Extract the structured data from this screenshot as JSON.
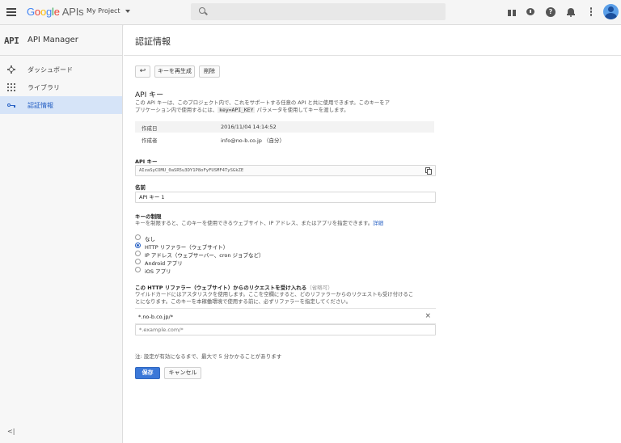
{
  "topbar": {
    "logo_google": [
      "G",
      "o",
      "o",
      "g",
      "l",
      "e"
    ],
    "logo_apis": "APIs",
    "project": "My Project",
    "search_placeholder": "",
    "help_glyph": "?"
  },
  "sidebar": {
    "logo_text": "API",
    "title": "API Manager",
    "items": [
      {
        "label": "ダッシュボード",
        "icon": "dashboard-icon"
      },
      {
        "label": "ライブラリ",
        "icon": "library-icon"
      },
      {
        "label": "認証情報",
        "icon": "key-icon",
        "active": true
      }
    ],
    "collapse_glyph": "<|"
  },
  "page": {
    "title": "認証情報"
  },
  "toolbar": {
    "back_glyph": "↩",
    "regenerate_label": "キーを再生成",
    "delete_label": "削除"
  },
  "apikey_section": {
    "title": "API キー",
    "desc_line1": "この API キーは、このプロジェクト内で、これをサポートする任意の API と共に使用できます。このキーをア",
    "desc_line2_pre": "プリケーション内で使用するには、",
    "desc_code": "key=API_KEY",
    "desc_line2_post": " パラメータを使用してキーを渡します。",
    "created_label": "作成日",
    "created_value": "2016/11/04 14:14:52",
    "creator_label": "作成者",
    "creator_value": "info@no-b.co.jp （自分）",
    "key_label": "API キー",
    "key_value": "AIzaSyCOMU_0aSR5u3DY1P8oFyFUSMF4TySGkZE",
    "name_label": "名前",
    "name_value": "API キー 1"
  },
  "restriction": {
    "title": "キーの制限",
    "desc": "キーを制限すると、このキーを使用できるウェブサイト、IP アドレス、またはアプリを指定できます。",
    "details_link": "詳細",
    "options": [
      {
        "label": "なし",
        "selected": false
      },
      {
        "label": "HTTP リファラー（ウェブサイト）",
        "selected": true
      },
      {
        "label": "IP アドレス（ウェブサーバー、cron ジョブなど）",
        "selected": false
      },
      {
        "label": "Android アプリ",
        "selected": false
      },
      {
        "label": "iOS アプリ",
        "selected": false
      }
    ]
  },
  "referrer": {
    "title": "この HTTP リファラー（ウェブサイト）からのリクエストを受け入れる",
    "optional": "（省略可）",
    "desc_line1": "ワイルドカードにはアスタリスクを使用します。ここを空欄にすると、どのリファラーからのリクエストも受け付けるこ",
    "desc_line2": "とになります。このキーを本稼働環境で使用する前に、必ずリファラーを指定してください。",
    "entry": "*.no-b.co.jp/*",
    "remove_glyph": "×",
    "placeholder": "*.example.com/*"
  },
  "footer": {
    "note": "注: 設定が有効になるまで、最大で 5 分かかることがあります",
    "save_label": "保存",
    "cancel_label": "キャンセル"
  }
}
